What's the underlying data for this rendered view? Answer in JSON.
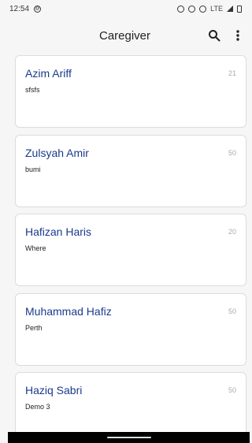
{
  "status_bar": {
    "time": "12:54",
    "network": "LTE"
  },
  "app_bar": {
    "title": "Caregiver"
  },
  "caregivers": [
    {
      "name": "Azim Ariff",
      "subtitle": "sfsfs",
      "count": "21"
    },
    {
      "name": "Zulsyah Amir",
      "subtitle": "bumi",
      "count": "50"
    },
    {
      "name": "Hafizan Haris",
      "subtitle": "Where",
      "count": "20"
    },
    {
      "name": "Muhammad Hafiz",
      "subtitle": "Perth",
      "count": "50"
    },
    {
      "name": "Haziq Sabri",
      "subtitle": "Demo 3",
      "count": "50"
    }
  ],
  "colors": {
    "name_text": "#1a3a8c",
    "background": "#f6f6f6",
    "card": "#ffffff"
  }
}
